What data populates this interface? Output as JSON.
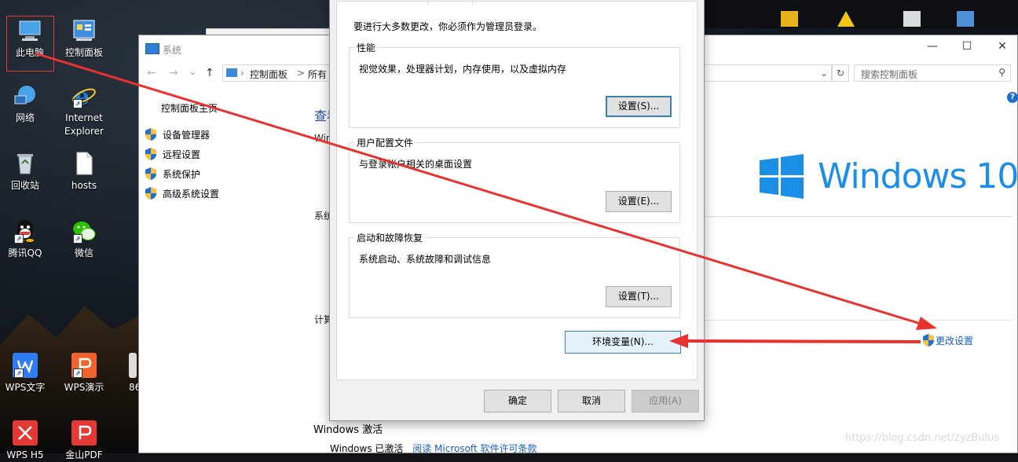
{
  "desktop": {
    "icons": [
      {
        "label": "此电脑",
        "icon": "this-pc-icon",
        "color": "#4aa3e8"
      },
      {
        "label": "控制面板",
        "icon": "control-panel-icon",
        "color": "#3b8ee0"
      },
      {
        "label": "网络",
        "icon": "network-icon",
        "color": "#4aa3e8"
      },
      {
        "label": "Internet Explorer",
        "icon": "ie-icon",
        "color": "#1c7ed6"
      },
      {
        "label": "回收站",
        "icon": "recycle-bin-icon",
        "color": "#cfd8e0"
      },
      {
        "label": "hosts",
        "icon": "file-icon",
        "color": "#ffffff"
      },
      {
        "label": "腾讯QQ",
        "icon": "qq-icon",
        "color": "#111111"
      },
      {
        "label": "微信",
        "icon": "wechat-icon",
        "color": "#2dc100"
      },
      {
        "label": "WPS文字",
        "icon": "wps-writer-icon",
        "color": "#2f7cf6"
      },
      {
        "label": "WPS演示",
        "icon": "wps-presentation-icon",
        "color": "#f0642c"
      },
      {
        "label": "86",
        "icon": "file-icon",
        "color": "#dddddd"
      },
      {
        "label": "WPS H5",
        "icon": "wps-h5-icon",
        "color": "#e53935"
      },
      {
        "label": "金山PDF",
        "icon": "wps-pdf-icon",
        "color": "#e53935"
      }
    ]
  },
  "system_window": {
    "title": "系统",
    "address": {
      "root": "控制面板",
      "sep": ">",
      "next": "所有"
    },
    "search_placeholder": "搜索控制面板",
    "sidebar": {
      "title": "控制面板主页",
      "links": [
        "设备管理器",
        "远程设置",
        "系统保护",
        "高级系统设置"
      ]
    },
    "main": {
      "view_heading_fragment": "查看",
      "edition_fragment": "Win",
      "system_fragment": "系统",
      "computer_fragment": "计算",
      "windows_logo_text": "Windows",
      "windows_logo_version": "10",
      "change_settings": "更改设置",
      "activation_title": "Windows 激活",
      "activation_status": "Windows 已激活",
      "license_link": "阅读 Microsoft 软件许可条款"
    }
  },
  "dialog": {
    "admin_notice": "要进行大多数更改，你必须作为管理员登录。",
    "groups": [
      {
        "title": "性能",
        "desc": "视觉效果，处理器计划，内存使用，以及虚拟内存",
        "button": "设置(S)..."
      },
      {
        "title": "用户配置文件",
        "desc": "与登录帐户相关的桌面设置",
        "button": "设置(E)..."
      },
      {
        "title": "启动和故障恢复",
        "desc": "系统启动、系统故障和调试信息",
        "button": "设置(T)..."
      }
    ],
    "env_button": "环境变量(N)...",
    "ok": "确定",
    "cancel": "取消",
    "apply": "应用(A)"
  },
  "colors": {
    "arrow": "#e8322f",
    "link": "#1a5ec2",
    "windows_blue": "#1b8ee6",
    "focus_border": "#3c7fb1"
  },
  "watermark": "https://blog.csdn.net/zyzBulus"
}
